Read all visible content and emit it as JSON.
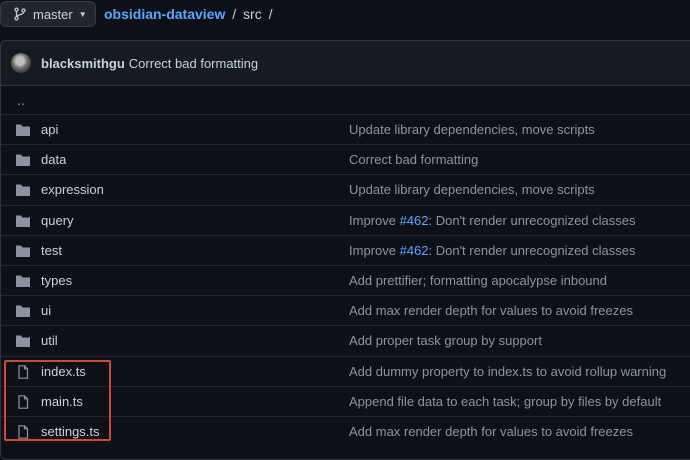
{
  "branch": {
    "name": "master",
    "icon": "git-branch-icon"
  },
  "breadcrumb": {
    "repo": "obsidian-dataview",
    "separator": "/",
    "folder": "src",
    "trailing": "/"
  },
  "latest_commit": {
    "author": "blacksmithgu",
    "message": "Correct bad formatting"
  },
  "parent_link": "..",
  "rows": [
    {
      "type": "folder",
      "name": "api",
      "commit": "Update library dependencies, move scripts"
    },
    {
      "type": "folder",
      "name": "data",
      "commit": "Correct bad formatting"
    },
    {
      "type": "folder",
      "name": "expression",
      "commit": "Update library dependencies, move scripts"
    },
    {
      "type": "folder",
      "name": "query",
      "commit_pre": "Improve ",
      "commit_ref": "#462",
      "commit_post": ": Don't render unrecognized classes"
    },
    {
      "type": "folder",
      "name": "test",
      "commit_pre": "Improve ",
      "commit_ref": "#462",
      "commit_post": ": Don't render unrecognized classes"
    },
    {
      "type": "folder",
      "name": "types",
      "commit": "Add prettifier; formatting apocalypse inbound"
    },
    {
      "type": "folder",
      "name": "ui",
      "commit": "Add max render depth for values to avoid freezes"
    },
    {
      "type": "folder",
      "name": "util",
      "commit": "Add proper task group by support"
    },
    {
      "type": "file",
      "name": "index.ts",
      "commit": "Add dummy property to index.ts to avoid rollup warning"
    },
    {
      "type": "file",
      "name": "main.ts",
      "commit": "Append file data to each task; group by files by default"
    },
    {
      "type": "file",
      "name": "settings.ts",
      "commit": "Add max render depth for values to avoid freezes"
    }
  ],
  "colors": {
    "background": "#0d1117",
    "link": "#58a6ff",
    "highlight_box": "#c94a35",
    "folder_icon": "#8b949e"
  }
}
